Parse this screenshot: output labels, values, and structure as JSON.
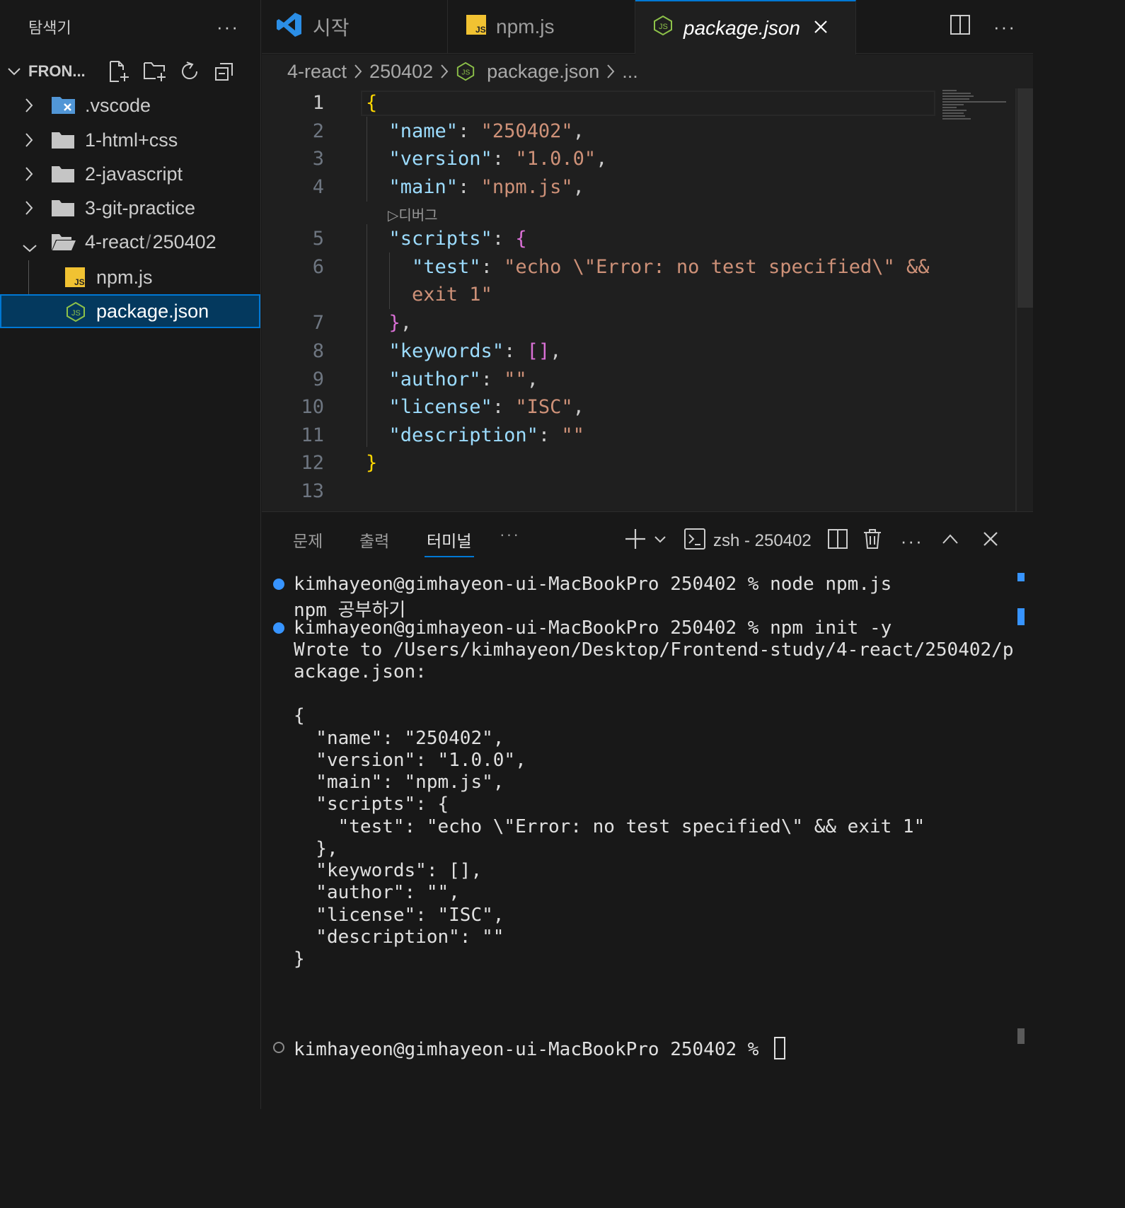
{
  "explorer": {
    "title": "탐색기",
    "more": "···",
    "section": "FRON...",
    "items": [
      {
        "label": ".vscode"
      },
      {
        "label": "1-html+css"
      },
      {
        "label": "2-javascript"
      },
      {
        "label": "3-git-practice"
      },
      {
        "label": "4-react",
        "label2": "250402",
        "separator": "/"
      },
      {
        "label": "npm.js"
      },
      {
        "label": "package.json"
      }
    ]
  },
  "tabs": [
    {
      "label": "시작"
    },
    {
      "label": "npm.js"
    },
    {
      "label": "package.json"
    }
  ],
  "tab_more": "···",
  "breadcrumb": [
    "4-react",
    "250402",
    "package.json",
    "..."
  ],
  "editor": {
    "line_numbers": [
      "1",
      "2",
      "3",
      "4",
      "5",
      "6",
      "7",
      "8",
      "9",
      "10",
      "11",
      "12",
      "13"
    ],
    "codelens": "▷디버그",
    "lines": [
      "{",
      "\"name\": \"250402\",",
      "\"version\": \"1.0.0\",",
      "\"main\": \"npm.js\",",
      "\"scripts\": {",
      "\"test\": \"echo \\\"Error: no test specified\\\" &&",
      "exit 1\"",
      "},",
      "\"keywords\": [],",
      "\"author\": \"\",",
      "\"license\": \"ISC\",",
      "\"description\": \"\"",
      "}"
    ]
  },
  "panel": {
    "tabs": [
      "문제",
      "출력",
      "터미널"
    ],
    "more": "···",
    "terminal_name": "zsh - 250402",
    "more2": "···",
    "terminal_lines": [
      "kimhayeon@gimhayeon-ui-MacBookPro 250402 % node npm.js",
      "npm 공부하기",
      "kimhayeon@gimhayeon-ui-MacBookPro 250402 % npm init -y",
      "Wrote to /Users/kimhayeon/Desktop/Frontend-study/4-react/250402/p",
      "ackage.json:",
      "{",
      "  \"name\": \"250402\",",
      "  \"version\": \"1.0.0\",",
      "  \"main\": \"npm.js\",",
      "  \"scripts\": {",
      "    \"test\": \"echo \\\"Error: no test specified\\\" && exit 1\"",
      "  },",
      "  \"keywords\": [],",
      "  \"author\": \"\",",
      "  \"license\": \"ISC\",",
      "  \"description\": \"\"",
      "}",
      "kimhayeon@gimhayeon-ui-MacBookPro 250402 % "
    ]
  },
  "colors": {
    "accent": "#0078d4",
    "json_key": "#9cdcfe",
    "json_string": "#ce9178",
    "bracket_1": "#ffd700",
    "bracket_2": "#da70d6",
    "bracket_3": "#179fff",
    "js_badge": "#f1c232",
    "json_icon": "#8dc149"
  },
  "icons": [
    "chevron-down-icon",
    "new-file-icon",
    "new-folder-icon",
    "refresh-icon",
    "collapse-all-icon",
    "chevron-right-icon",
    "vscode-folder-icon",
    "folder-icon",
    "folder-open-icon",
    "js-file-icon",
    "json-file-icon",
    "vscode-logo-icon",
    "close-icon",
    "split-editor-icon",
    "more-icon",
    "plus-icon",
    "terminal-icon",
    "trash-icon",
    "chevron-up-icon"
  ]
}
